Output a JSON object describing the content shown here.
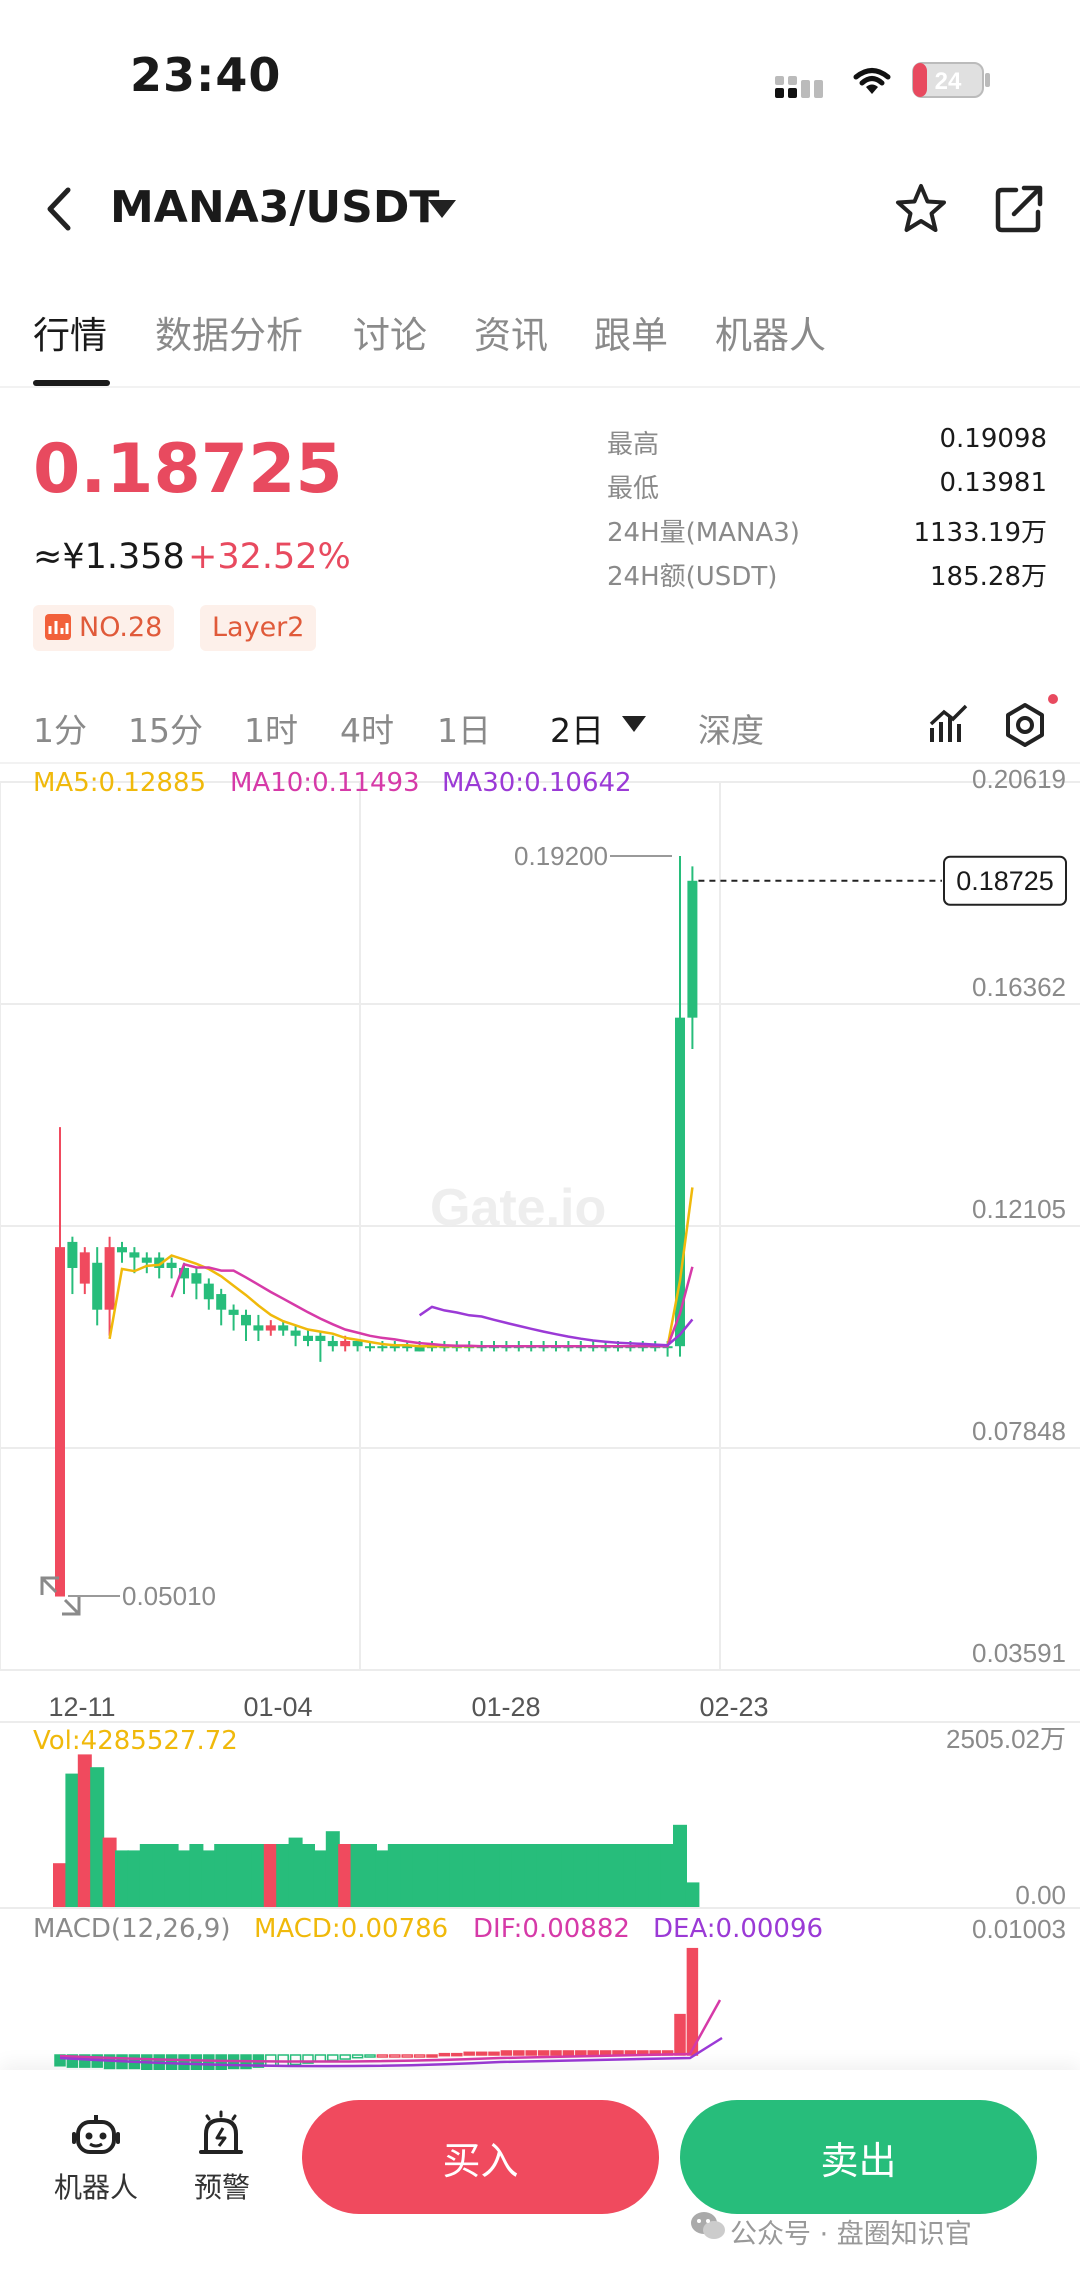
{
  "status": {
    "time": "23:40",
    "battery": "24"
  },
  "nav": {
    "pair": "MANA3/USDT"
  },
  "tabs": [
    "行情",
    "数据分析",
    "讨论",
    "资讯",
    "跟单",
    "机器人"
  ],
  "price": {
    "last": "0.18725",
    "cny": "≈¥1.358",
    "change": "+32.52%"
  },
  "tags": {
    "rank": "NO.28",
    "category": "Layer2"
  },
  "stats": [
    {
      "label": "最高",
      "value": "0.19098"
    },
    {
      "label": "最低",
      "value": "0.13981"
    },
    {
      "label": "24H量(MANA3)",
      "value": "1133.19万"
    },
    {
      "label": "24H额(USDT)",
      "value": "185.28万"
    }
  ],
  "timeframes": [
    "1分",
    "15分",
    "1时",
    "4时",
    "1日",
    "2日",
    "深度"
  ],
  "indicators": {
    "ma5": "MA5:0.12885",
    "ma10": "MA10:0.11493",
    "ma30": "MA30:0.10642",
    "vol": "Vol:4285527.72",
    "macd_title": "MACD(12,26,9)",
    "macd": "MACD:0.00786",
    "dif": "DIF:0.00882",
    "dea": "DEA:0.00096"
  },
  "colors": {
    "up": "#27bd7b",
    "down": "#f04a5e",
    "ma5": "#f0b90b",
    "ma10": "#d63aa8",
    "ma30": "#9b3ad6"
  },
  "chart_data": {
    "type": "candlestick",
    "y_axis_ticks": [
      "0.20619",
      "0.16362",
      "0.12105",
      "0.07848",
      "0.03591"
    ],
    "ylim": [
      0.03591,
      0.20619
    ],
    "x_axis_ticks": [
      "12-11",
      "01-04",
      "01-28",
      "02-23"
    ],
    "high_marker": "0.19200",
    "low_marker": "0.05010",
    "last_price_label": "0.18725",
    "watermark": "Gate.io",
    "candles": [
      {
        "o": 0.117,
        "h": 0.14,
        "l": 0.05,
        "c": 0.05
      },
      {
        "o": 0.113,
        "h": 0.119,
        "l": 0.108,
        "c": 0.118
      },
      {
        "o": 0.116,
        "h": 0.117,
        "l": 0.108,
        "c": 0.11
      },
      {
        "o": 0.105,
        "h": 0.117,
        "l": 0.102,
        "c": 0.114
      },
      {
        "o": 0.117,
        "h": 0.119,
        "l": 0.1,
        "c": 0.105
      },
      {
        "o": 0.116,
        "h": 0.118,
        "l": 0.114,
        "c": 0.117
      },
      {
        "o": 0.115,
        "h": 0.117,
        "l": 0.112,
        "c": 0.116
      },
      {
        "o": 0.114,
        "h": 0.116,
        "l": 0.112,
        "c": 0.115
      },
      {
        "o": 0.113,
        "h": 0.116,
        "l": 0.111,
        "c": 0.115
      },
      {
        "o": 0.113,
        "h": 0.115,
        "l": 0.111,
        "c": 0.114
      },
      {
        "o": 0.111,
        "h": 0.114,
        "l": 0.108,
        "c": 0.113
      },
      {
        "o": 0.11,
        "h": 0.113,
        "l": 0.107,
        "c": 0.112
      },
      {
        "o": 0.107,
        "h": 0.111,
        "l": 0.105,
        "c": 0.11
      },
      {
        "o": 0.105,
        "h": 0.109,
        "l": 0.102,
        "c": 0.108
      },
      {
        "o": 0.104,
        "h": 0.106,
        "l": 0.101,
        "c": 0.105
      },
      {
        "o": 0.102,
        "h": 0.105,
        "l": 0.099,
        "c": 0.104
      },
      {
        "o": 0.101,
        "h": 0.104,
        "l": 0.099,
        "c": 0.102
      },
      {
        "o": 0.102,
        "h": 0.103,
        "l": 0.1,
        "c": 0.101
      },
      {
        "o": 0.101,
        "h": 0.103,
        "l": 0.1,
        "c": 0.102
      },
      {
        "o": 0.1,
        "h": 0.102,
        "l": 0.098,
        "c": 0.101
      },
      {
        "o": 0.099,
        "h": 0.101,
        "l": 0.098,
        "c": 0.1
      },
      {
        "o": 0.099,
        "h": 0.101,
        "l": 0.095,
        "c": 0.1
      },
      {
        "o": 0.098,
        "h": 0.1,
        "l": 0.097,
        "c": 0.099
      },
      {
        "o": 0.099,
        "h": 0.1,
        "l": 0.097,
        "c": 0.098
      },
      {
        "o": 0.098,
        "h": 0.099,
        "l": 0.097,
        "c": 0.099
      },
      {
        "o": 0.098,
        "h": 0.099,
        "l": 0.097,
        "c": 0.098
      },
      {
        "o": 0.098,
        "h": 0.099,
        "l": 0.097,
        "c": 0.098
      },
      {
        "o": 0.098,
        "h": 0.099,
        "l": 0.097,
        "c": 0.098
      },
      {
        "o": 0.098,
        "h": 0.099,
        "l": 0.097,
        "c": 0.098
      },
      {
        "o": 0.097,
        "h": 0.099,
        "l": 0.097,
        "c": 0.098
      },
      {
        "o": 0.098,
        "h": 0.099,
        "l": 0.097,
        "c": 0.098
      },
      {
        "o": 0.098,
        "h": 0.099,
        "l": 0.097,
        "c": 0.098
      },
      {
        "o": 0.098,
        "h": 0.099,
        "l": 0.097,
        "c": 0.098
      },
      {
        "o": 0.098,
        "h": 0.099,
        "l": 0.097,
        "c": 0.098
      },
      {
        "o": 0.098,
        "h": 0.099,
        "l": 0.097,
        "c": 0.098
      },
      {
        "o": 0.098,
        "h": 0.099,
        "l": 0.097,
        "c": 0.098
      },
      {
        "o": 0.098,
        "h": 0.099,
        "l": 0.097,
        "c": 0.098
      },
      {
        "o": 0.098,
        "h": 0.099,
        "l": 0.097,
        "c": 0.098
      },
      {
        "o": 0.098,
        "h": 0.099,
        "l": 0.097,
        "c": 0.098
      },
      {
        "o": 0.098,
        "h": 0.099,
        "l": 0.097,
        "c": 0.098
      },
      {
        "o": 0.098,
        "h": 0.099,
        "l": 0.097,
        "c": 0.098
      },
      {
        "o": 0.098,
        "h": 0.099,
        "l": 0.097,
        "c": 0.098
      },
      {
        "o": 0.098,
        "h": 0.099,
        "l": 0.097,
        "c": 0.098
      },
      {
        "o": 0.098,
        "h": 0.099,
        "l": 0.097,
        "c": 0.098
      },
      {
        "o": 0.098,
        "h": 0.099,
        "l": 0.097,
        "c": 0.098
      },
      {
        "o": 0.098,
        "h": 0.099,
        "l": 0.097,
        "c": 0.098
      },
      {
        "o": 0.098,
        "h": 0.099,
        "l": 0.097,
        "c": 0.098
      },
      {
        "o": 0.098,
        "h": 0.099,
        "l": 0.097,
        "c": 0.098
      },
      {
        "o": 0.098,
        "h": 0.099,
        "l": 0.097,
        "c": 0.098
      },
      {
        "o": 0.098,
        "h": 0.099,
        "l": 0.096,
        "c": 0.098
      },
      {
        "o": 0.098,
        "h": 0.192,
        "l": 0.096,
        "c": 0.161
      },
      {
        "o": 0.161,
        "h": 0.19,
        "l": 0.155,
        "c": 0.18725
      }
    ],
    "volume": {
      "max_label": "2505.02万",
      "min_label": "0.00",
      "values": [
        7,
        21,
        24,
        22,
        11,
        9,
        9,
        10,
        10,
        10,
        9,
        10,
        9,
        10,
        10,
        10,
        10,
        10,
        10,
        11,
        10,
        9,
        12,
        10,
        10,
        10,
        9,
        10,
        10,
        10,
        10,
        10,
        10,
        10,
        10,
        10,
        10,
        10,
        10,
        10,
        10,
        10,
        10,
        10,
        10,
        10,
        10,
        10,
        10,
        10,
        13,
        4
      ]
    },
    "macd": {
      "top_label": "0.01003",
      "hist": [
        -0.0008,
        -0.0009,
        -0.0009,
        -0.0009,
        -0.001,
        -0.001,
        -0.001,
        -0.0011,
        -0.0011,
        -0.0011,
        -0.0011,
        -0.0011,
        -0.0011,
        -0.0011,
        -0.001,
        -0.001,
        -0.0009,
        -0.0008,
        -0.0008,
        -0.0007,
        -0.0006,
        -0.0005,
        -0.0004,
        -0.0003,
        -0.0002,
        -0.0001,
        0,
        0,
        0,
        0,
        0,
        0.0001,
        0.0001,
        0.0002,
        0.0002,
        0.0002,
        0.0003,
        0.0003,
        0.0003,
        0.0003,
        0.0003,
        0.0003,
        0.0003,
        0.0003,
        0.0003,
        0.0003,
        0.0003,
        0.0003,
        0.0003,
        0.0003,
        0.003,
        0.0079
      ]
    }
  },
  "bottom": {
    "robot": "机器人",
    "alert": "预警",
    "buy": "买入",
    "sell": "卖出"
  },
  "watermark_text": "公众号 · 盘圈知识官"
}
